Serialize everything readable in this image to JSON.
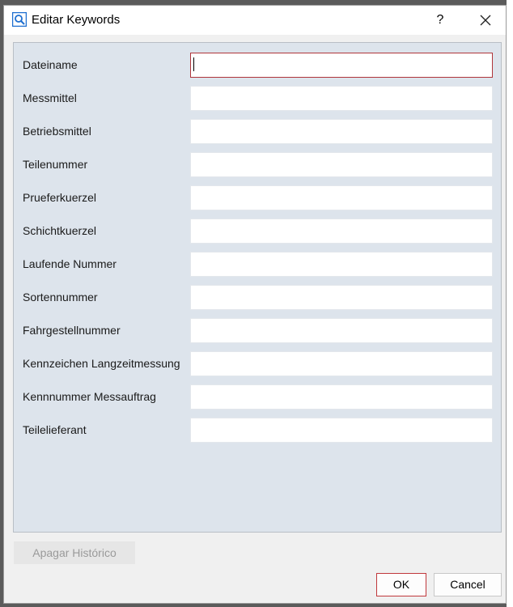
{
  "window": {
    "title": "Editar Keywords",
    "help_label": "?",
    "icon": "search-icon",
    "close_icon": "close-icon"
  },
  "fields": [
    {
      "label": "Dateiname",
      "value": "",
      "focused": true
    },
    {
      "label": "Messmittel",
      "value": ""
    },
    {
      "label": "Betriebsmittel",
      "value": ""
    },
    {
      "label": "Teilenummer",
      "value": ""
    },
    {
      "label": "Prueferkuerzel",
      "value": ""
    },
    {
      "label": "Schichtkuerzel",
      "value": ""
    },
    {
      "label": "Laufende Nummer",
      "value": ""
    },
    {
      "label": "Sortennummer",
      "value": ""
    },
    {
      "label": "Fahrgestellnummer",
      "value": ""
    },
    {
      "label": "Kennzeichen Langzeitmessung",
      "value": ""
    },
    {
      "label": "Kennnummer Messauftrag",
      "value": ""
    },
    {
      "label": "Teilelieferant",
      "value": ""
    }
  ],
  "buttons": {
    "history": "Apagar Histórico",
    "ok": "OK",
    "cancel": "Cancel"
  },
  "colors": {
    "panel_bg": "#dde4ec",
    "focus_border": "#b0353b",
    "icon_blue": "#1e6fd0"
  }
}
